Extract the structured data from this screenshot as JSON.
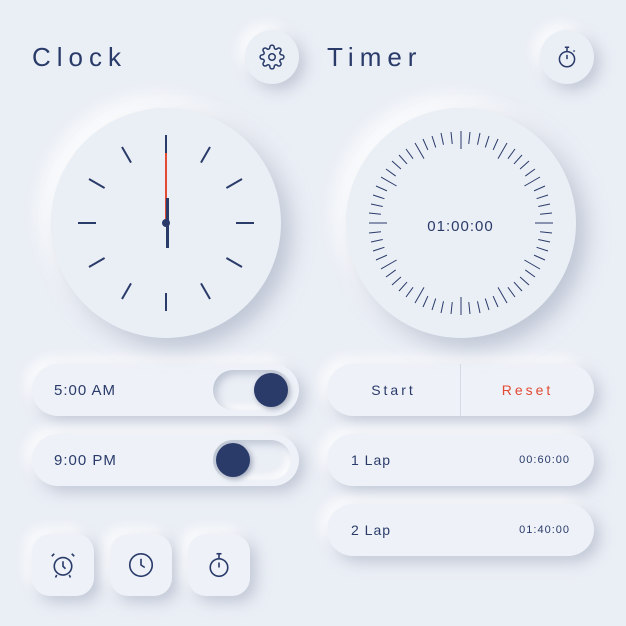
{
  "clock": {
    "title": "Clock",
    "alarms": [
      {
        "time": "5:00 AM",
        "on": true
      },
      {
        "time": "9:00 PM",
        "on": false
      }
    ]
  },
  "timer": {
    "title": "Timer",
    "value": "01:00:00",
    "start_label": "Start",
    "reset_label": "Reset",
    "laps": [
      {
        "name": "1 Lap",
        "time": "00:60:00"
      },
      {
        "name": "2 Lap",
        "time": "01:40:00"
      }
    ]
  },
  "colors": {
    "accent": "#2a3b6a",
    "danger": "#e24a33",
    "bg": "#eaeef5"
  }
}
